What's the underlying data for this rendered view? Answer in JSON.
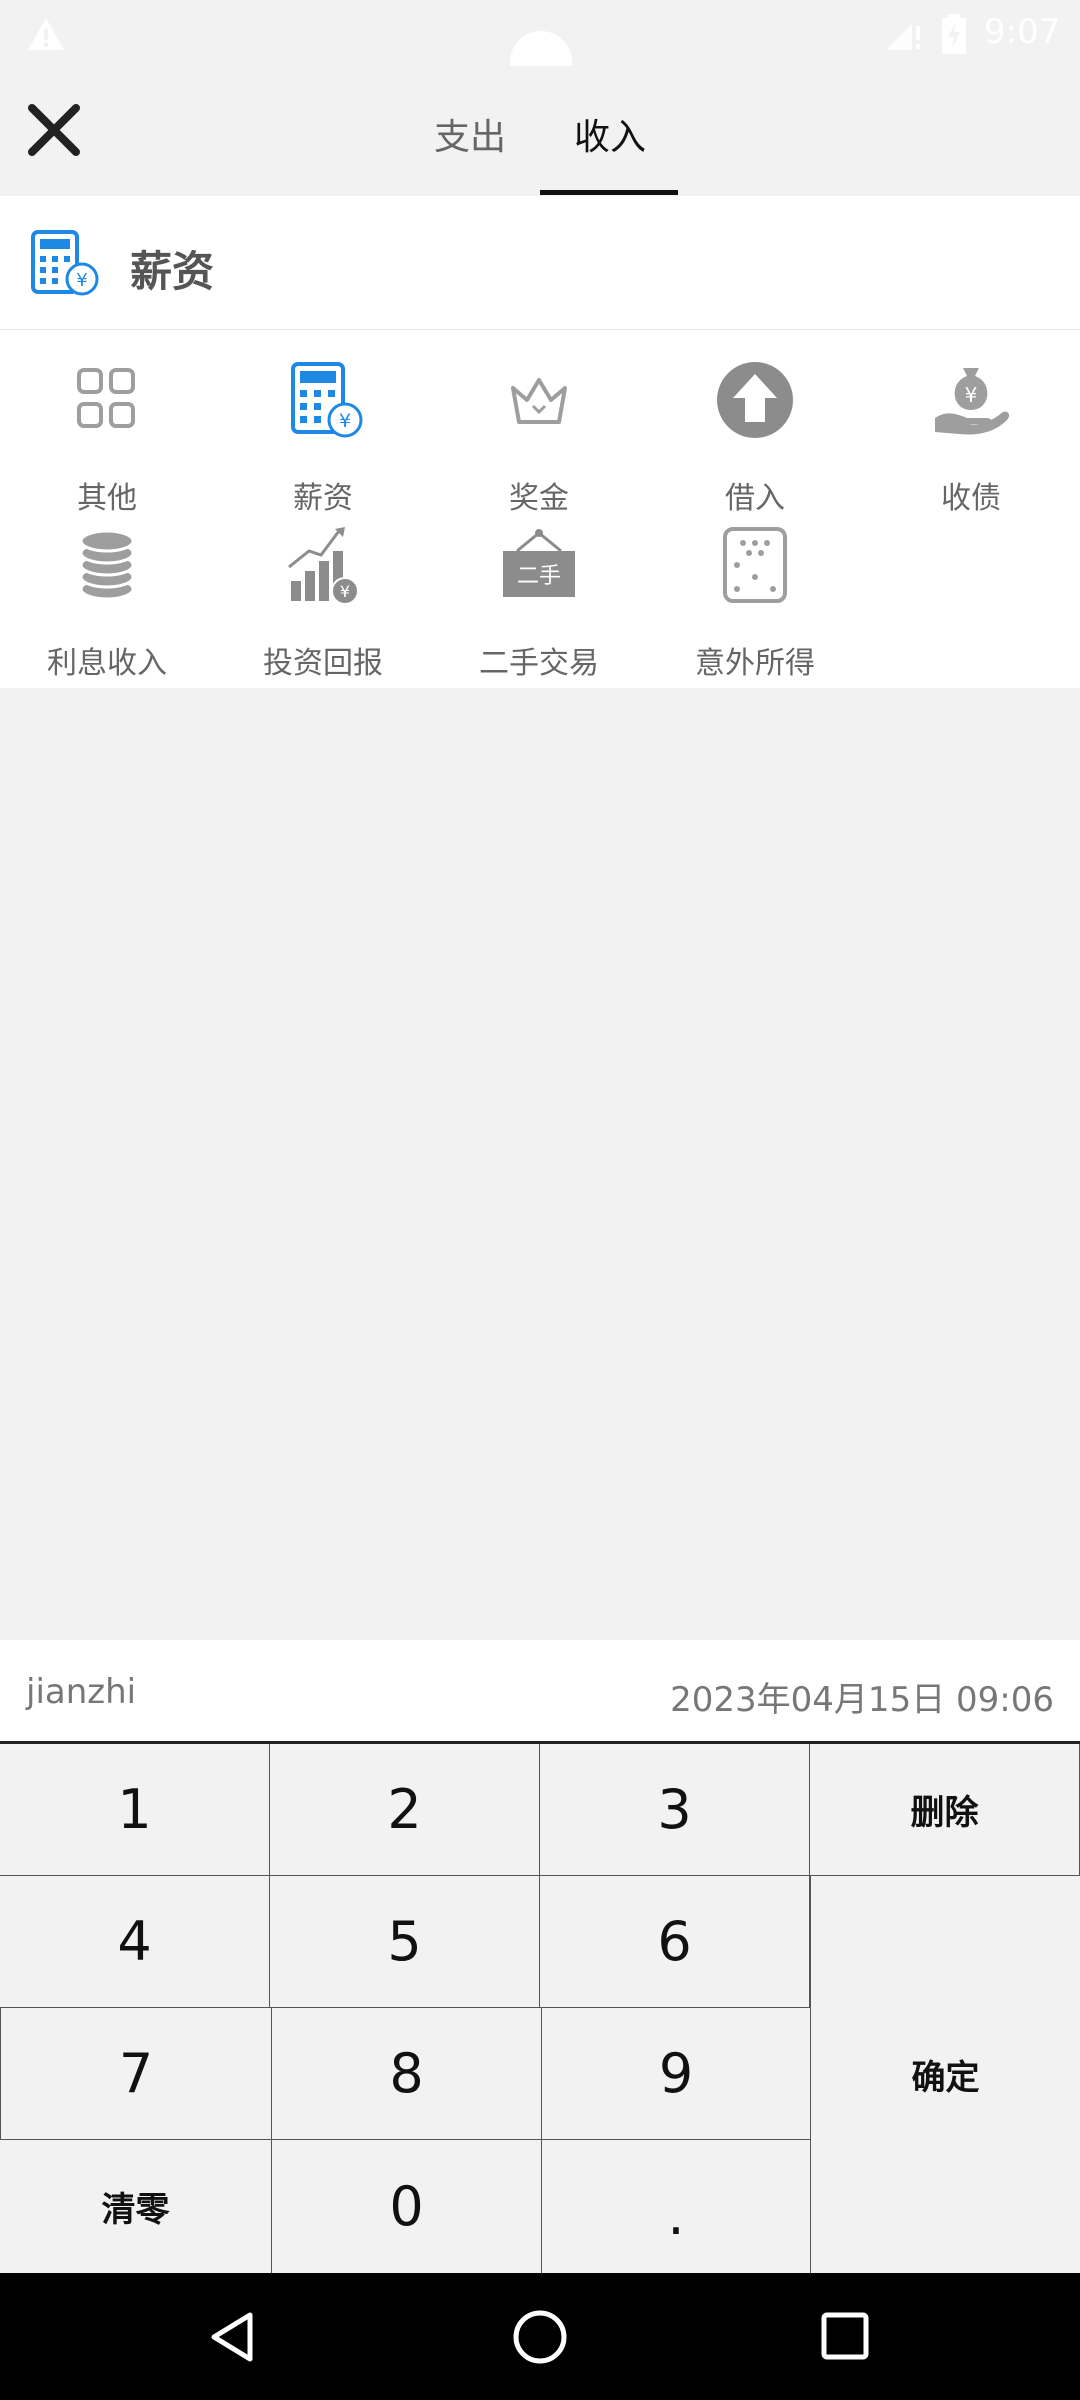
{
  "status_bar": {
    "time": "9:07",
    "icons": [
      "warning-icon",
      "signal-icon",
      "battery-charging-icon"
    ]
  },
  "header": {
    "close_icon": "close-icon",
    "tabs": [
      {
        "label": "支出",
        "active": false
      },
      {
        "label": "收入",
        "active": true
      }
    ]
  },
  "selected_category": {
    "icon": "salary-calculator-icon",
    "label": "薪资"
  },
  "categories": [
    {
      "label": "其他",
      "icon": "grid-icon",
      "selected": false
    },
    {
      "label": "薪资",
      "icon": "salary-calculator-icon",
      "selected": true
    },
    {
      "label": "奖金",
      "icon": "crown-icon",
      "selected": false
    },
    {
      "label": "借入",
      "icon": "upload-arrow-icon",
      "selected": false
    },
    {
      "label": "收债",
      "icon": "money-bag-hand-icon",
      "selected": false
    },
    {
      "label": "利息收入",
      "icon": "coin-stack-icon",
      "selected": false
    },
    {
      "label": "投资回报",
      "icon": "growth-chart-icon",
      "selected": false
    },
    {
      "label": "二手交易",
      "icon": "secondhand-sign-icon",
      "selected": false
    },
    {
      "label": "意外所得",
      "icon": "dice-icon",
      "selected": false
    }
  ],
  "entry": {
    "note": "jianzhi",
    "datetime": "2023年04月15日 09:06"
  },
  "keypad": {
    "k1": "1",
    "k2": "2",
    "k3": "3",
    "k4": "4",
    "k5": "5",
    "k6": "6",
    "k7": "7",
    "k8": "8",
    "k9": "9",
    "k0": "0",
    "dot": ".",
    "delete": "删除",
    "confirm": "确定",
    "clear": "清零"
  },
  "nav_bar": {
    "icons": [
      "back-triangle-icon",
      "home-circle-icon",
      "recent-square-icon"
    ]
  },
  "colors": {
    "accent_blue": "#1e88e5",
    "icon_gray": "#9e9e9e",
    "background": "#f2f2f2"
  }
}
